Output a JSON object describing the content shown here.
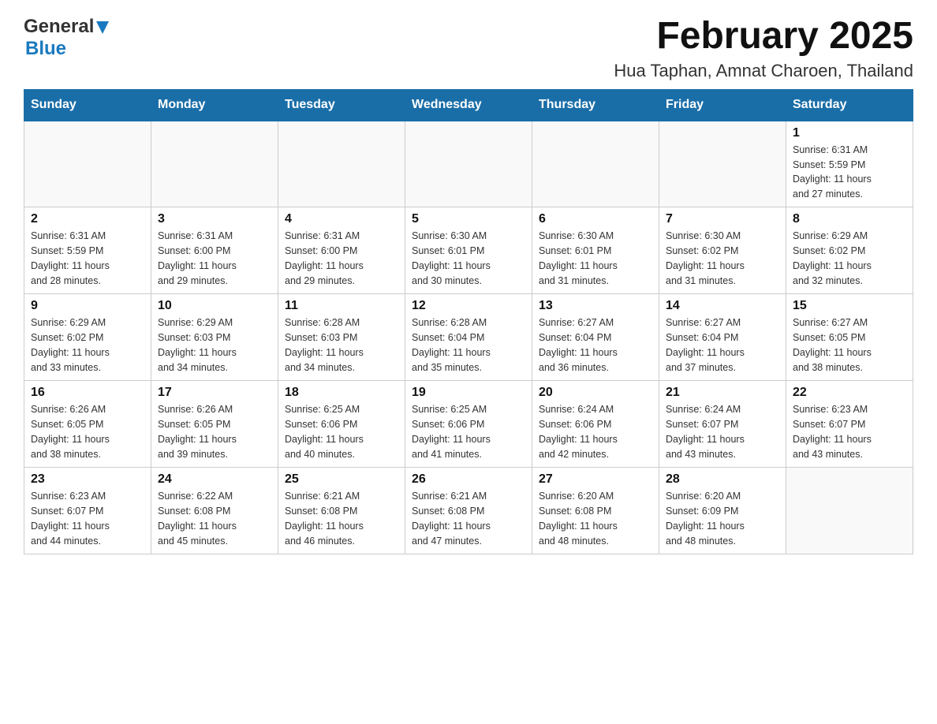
{
  "header": {
    "logo_general": "General",
    "logo_blue": "Blue",
    "title": "February 2025",
    "subtitle": "Hua Taphan, Amnat Charoen, Thailand"
  },
  "days_of_week": [
    "Sunday",
    "Monday",
    "Tuesday",
    "Wednesday",
    "Thursday",
    "Friday",
    "Saturday"
  ],
  "weeks": [
    {
      "days": [
        {
          "num": "",
          "info": ""
        },
        {
          "num": "",
          "info": ""
        },
        {
          "num": "",
          "info": ""
        },
        {
          "num": "",
          "info": ""
        },
        {
          "num": "",
          "info": ""
        },
        {
          "num": "",
          "info": ""
        },
        {
          "num": "1",
          "info": "Sunrise: 6:31 AM\nSunset: 5:59 PM\nDaylight: 11 hours\nand 27 minutes."
        }
      ]
    },
    {
      "days": [
        {
          "num": "2",
          "info": "Sunrise: 6:31 AM\nSunset: 5:59 PM\nDaylight: 11 hours\nand 28 minutes."
        },
        {
          "num": "3",
          "info": "Sunrise: 6:31 AM\nSunset: 6:00 PM\nDaylight: 11 hours\nand 29 minutes."
        },
        {
          "num": "4",
          "info": "Sunrise: 6:31 AM\nSunset: 6:00 PM\nDaylight: 11 hours\nand 29 minutes."
        },
        {
          "num": "5",
          "info": "Sunrise: 6:30 AM\nSunset: 6:01 PM\nDaylight: 11 hours\nand 30 minutes."
        },
        {
          "num": "6",
          "info": "Sunrise: 6:30 AM\nSunset: 6:01 PM\nDaylight: 11 hours\nand 31 minutes."
        },
        {
          "num": "7",
          "info": "Sunrise: 6:30 AM\nSunset: 6:02 PM\nDaylight: 11 hours\nand 31 minutes."
        },
        {
          "num": "8",
          "info": "Sunrise: 6:29 AM\nSunset: 6:02 PM\nDaylight: 11 hours\nand 32 minutes."
        }
      ]
    },
    {
      "days": [
        {
          "num": "9",
          "info": "Sunrise: 6:29 AM\nSunset: 6:02 PM\nDaylight: 11 hours\nand 33 minutes."
        },
        {
          "num": "10",
          "info": "Sunrise: 6:29 AM\nSunset: 6:03 PM\nDaylight: 11 hours\nand 34 minutes."
        },
        {
          "num": "11",
          "info": "Sunrise: 6:28 AM\nSunset: 6:03 PM\nDaylight: 11 hours\nand 34 minutes."
        },
        {
          "num": "12",
          "info": "Sunrise: 6:28 AM\nSunset: 6:04 PM\nDaylight: 11 hours\nand 35 minutes."
        },
        {
          "num": "13",
          "info": "Sunrise: 6:27 AM\nSunset: 6:04 PM\nDaylight: 11 hours\nand 36 minutes."
        },
        {
          "num": "14",
          "info": "Sunrise: 6:27 AM\nSunset: 6:04 PM\nDaylight: 11 hours\nand 37 minutes."
        },
        {
          "num": "15",
          "info": "Sunrise: 6:27 AM\nSunset: 6:05 PM\nDaylight: 11 hours\nand 38 minutes."
        }
      ]
    },
    {
      "days": [
        {
          "num": "16",
          "info": "Sunrise: 6:26 AM\nSunset: 6:05 PM\nDaylight: 11 hours\nand 38 minutes."
        },
        {
          "num": "17",
          "info": "Sunrise: 6:26 AM\nSunset: 6:05 PM\nDaylight: 11 hours\nand 39 minutes."
        },
        {
          "num": "18",
          "info": "Sunrise: 6:25 AM\nSunset: 6:06 PM\nDaylight: 11 hours\nand 40 minutes."
        },
        {
          "num": "19",
          "info": "Sunrise: 6:25 AM\nSunset: 6:06 PM\nDaylight: 11 hours\nand 41 minutes."
        },
        {
          "num": "20",
          "info": "Sunrise: 6:24 AM\nSunset: 6:06 PM\nDaylight: 11 hours\nand 42 minutes."
        },
        {
          "num": "21",
          "info": "Sunrise: 6:24 AM\nSunset: 6:07 PM\nDaylight: 11 hours\nand 43 minutes."
        },
        {
          "num": "22",
          "info": "Sunrise: 6:23 AM\nSunset: 6:07 PM\nDaylight: 11 hours\nand 43 minutes."
        }
      ]
    },
    {
      "days": [
        {
          "num": "23",
          "info": "Sunrise: 6:23 AM\nSunset: 6:07 PM\nDaylight: 11 hours\nand 44 minutes."
        },
        {
          "num": "24",
          "info": "Sunrise: 6:22 AM\nSunset: 6:08 PM\nDaylight: 11 hours\nand 45 minutes."
        },
        {
          "num": "25",
          "info": "Sunrise: 6:21 AM\nSunset: 6:08 PM\nDaylight: 11 hours\nand 46 minutes."
        },
        {
          "num": "26",
          "info": "Sunrise: 6:21 AM\nSunset: 6:08 PM\nDaylight: 11 hours\nand 47 minutes."
        },
        {
          "num": "27",
          "info": "Sunrise: 6:20 AM\nSunset: 6:08 PM\nDaylight: 11 hours\nand 48 minutes."
        },
        {
          "num": "28",
          "info": "Sunrise: 6:20 AM\nSunset: 6:09 PM\nDaylight: 11 hours\nand 48 minutes."
        },
        {
          "num": "",
          "info": ""
        }
      ]
    }
  ]
}
